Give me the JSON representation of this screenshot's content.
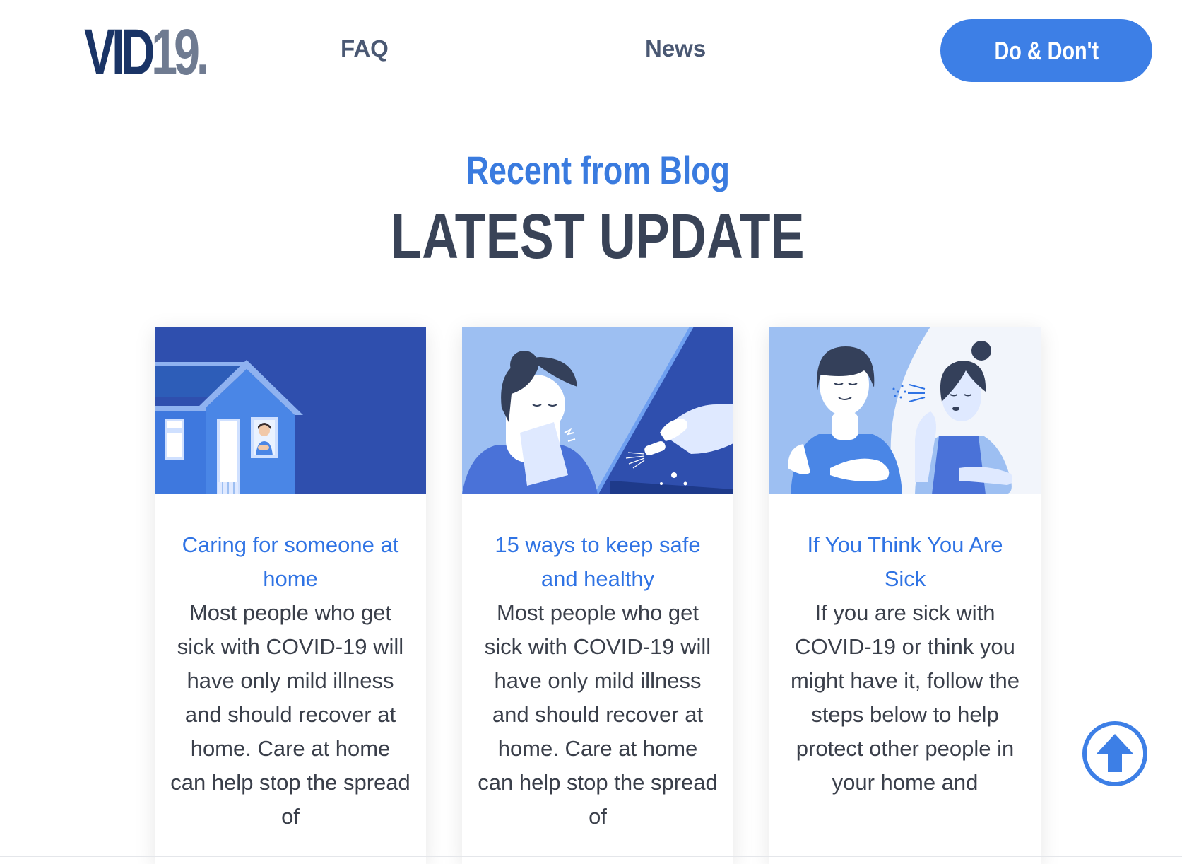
{
  "header": {
    "logo": {
      "part1": "VID",
      "part2": "19."
    },
    "nav": {
      "faq": "FAQ",
      "news": "News"
    },
    "cta_label": "Do & Don't"
  },
  "section": {
    "eyebrow": "Recent from Blog",
    "title": "LATEST UPDATE"
  },
  "cards": [
    {
      "title": "Caring for someone at home",
      "excerpt": "Most people who get sick with COVID-19 will have only mild illness and should recover at home. Care at home can help stop the spread of",
      "image": "house-illustration"
    },
    {
      "title": "15 ways to keep safe and healthy",
      "excerpt": "Most people who get sick with COVID-19 will have only mild illness and should recover at home. Care at home can help stop the spread of",
      "image": "sneeze-and-disinfect-illustration"
    },
    {
      "title": "If You Think You Are Sick",
      "excerpt": "If you are sick with COVID-19 or think you might have it, follow the steps below to help protect other people in your home and",
      "image": "cough-illustration"
    }
  ],
  "scroll_top": {
    "icon": "arrow-up-icon"
  },
  "colors": {
    "accent": "#3d7fe6",
    "logo_dark": "#1a3466",
    "logo_gray": "#6f7b91",
    "heading": "#394357",
    "link": "#2f73e4",
    "illustration_dark": "#2f4fae",
    "illustration_light": "#9dbff2"
  }
}
